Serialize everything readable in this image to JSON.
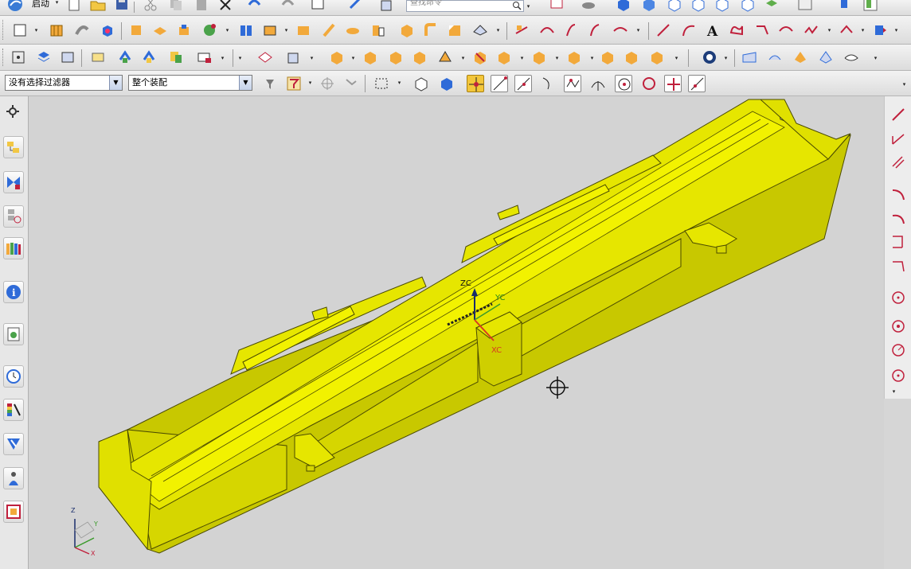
{
  "app": {
    "name": "NX",
    "start_label": "启动",
    "search_placeholder": "查找命令"
  },
  "filters": {
    "selection_filter": "没有选择过滤器",
    "scope": "整个装配"
  },
  "viewport": {
    "csys_labels": {
      "zc": "ZC",
      "yc": "YC",
      "xc": "XC"
    },
    "triad_labels": {
      "z": "Z",
      "y": "Y",
      "x": "X"
    },
    "part_color": "#e6e600",
    "background_color": "#d3d3d3"
  },
  "resource_bar": {
    "items": [
      "settings-icon",
      "assembly-navigator-icon",
      "constraint-navigator-icon",
      "part-navigator-icon",
      "reuse-library-icon",
      "help-icon",
      "web-browser-icon",
      "history-icon",
      "system-materials-icon",
      "process-studio-icon",
      "roles-icon",
      "palette-icon"
    ]
  },
  "colors": {
    "toolbar_bg": "#e6e6e6",
    "accent_blue": "#2f6bd8",
    "curve_red": "#c0203c",
    "part_yellow": "#e6e600"
  }
}
